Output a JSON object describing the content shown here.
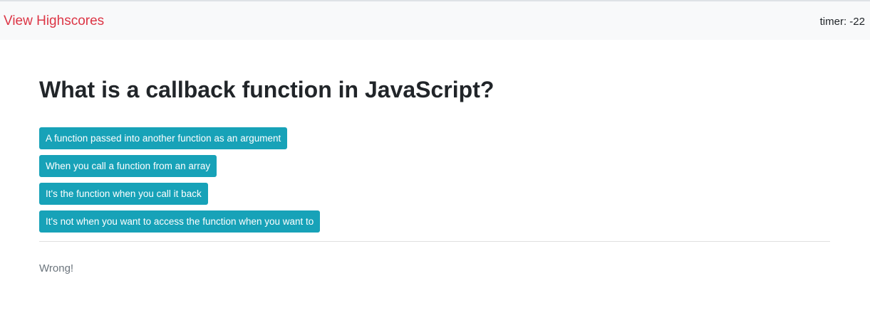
{
  "nav": {
    "highscores_link": "View Highscores",
    "timer": "timer: -22"
  },
  "question": "What is a callback function in JavaScript?",
  "answers": [
    "A function passed into another function as an argument",
    "When you call a function from an array",
    "It's the function when you call it back",
    "It's not when you want to access the function when you want to"
  ],
  "result": "Wrong!",
  "colors": {
    "accent": "#17a2b8",
    "link": "#dc3545"
  }
}
